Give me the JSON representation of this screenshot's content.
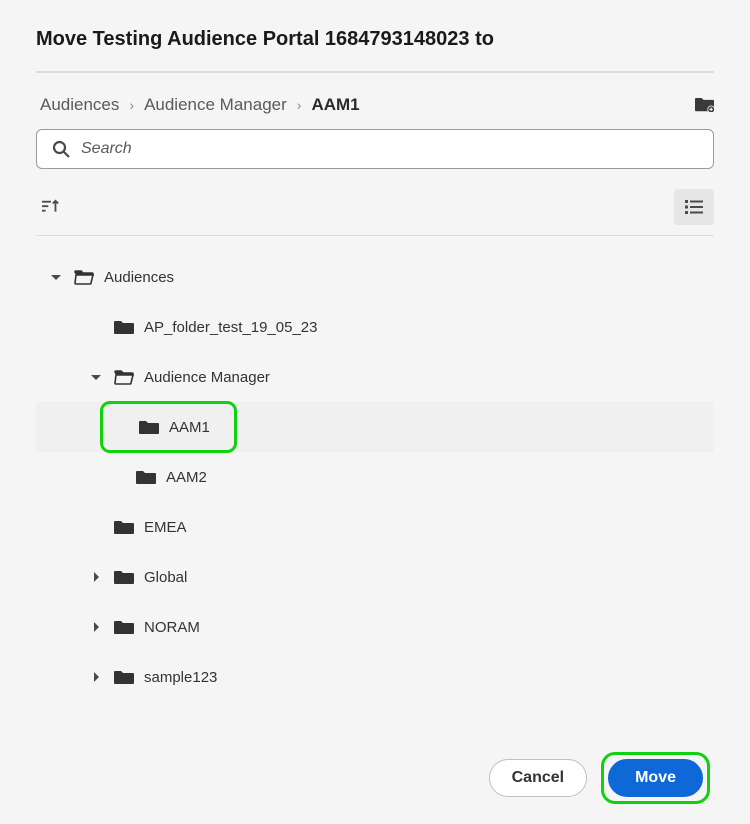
{
  "title": "Move Testing Audience Portal 1684793148023 to",
  "breadcrumb": {
    "items": [
      "Audiences",
      "Audience Manager"
    ],
    "current": "AAM1"
  },
  "search": {
    "placeholder": "Search"
  },
  "tree": {
    "root": {
      "label": "Audiences"
    },
    "items": [
      {
        "label": "AP_folder_test_19_05_23"
      },
      {
        "label": "Audience Manager",
        "children": [
          {
            "label": "AAM1",
            "selected": true
          },
          {
            "label": "AAM2"
          }
        ]
      },
      {
        "label": "EMEA"
      },
      {
        "label": "Global"
      },
      {
        "label": "NORAM"
      },
      {
        "label": "sample123"
      }
    ]
  },
  "buttons": {
    "cancel": "Cancel",
    "move": "Move"
  },
  "highlight_color": "#10d010",
  "accent_color": "#0f68d8"
}
